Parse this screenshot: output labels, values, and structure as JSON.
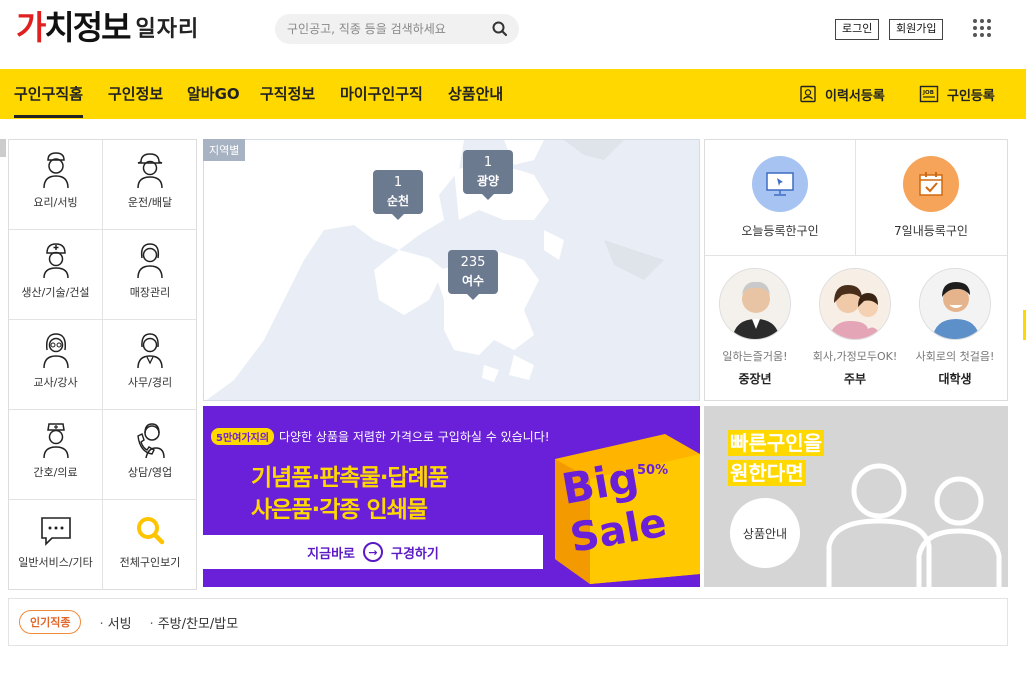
{
  "header": {
    "logo_brand": "가치정보",
    "logo_sub": "일자리",
    "search_placeholder": "구인공고, 직종 등을 검색하세요",
    "login": "로그인",
    "signup": "회원가입"
  },
  "nav": {
    "items": [
      "구인구직홈",
      "구인정보",
      "알바GO",
      "구직정보",
      "마이구인구직",
      "상품안내"
    ],
    "resume_register": "이력서등록",
    "job_register": "구인등록"
  },
  "categories": [
    "요리/서빙",
    "운전/배달",
    "생산/기술/건설",
    "매장관리",
    "교사/강사",
    "사무/경리",
    "간호/의료",
    "상담/영업",
    "일반서비스/기타",
    "전체구인보기"
  ],
  "map": {
    "tag": "지역별",
    "pins": [
      {
        "count": "1",
        "name": "순천"
      },
      {
        "count": "1",
        "name": "광양"
      },
      {
        "count": "235",
        "name": "여수"
      }
    ]
  },
  "right_panel": {
    "today": "오늘등록한구인",
    "week": "7일내등록구인",
    "personas": [
      {
        "desc": "일하는즐거움!",
        "name": "중장년"
      },
      {
        "desc": "회사,가정모두OK!",
        "name": "주부"
      },
      {
        "desc": "사회로의 첫걸음!",
        "name": "대학생"
      }
    ]
  },
  "banner": {
    "pill": "5만여가지의",
    "top_line": "다양한 상품을 저렴한 가격으로 구입하실 수 있습니다!",
    "line1": "기념품·판촉물·답례품",
    "line2": "사은품·각종 인쇄물",
    "cta_left": "지금바로",
    "cta_right": "구경하기",
    "percent": "50%",
    "big": "Big",
    "sale": "Sale"
  },
  "promo": {
    "line1": "빠른구인을",
    "line2": "원한다면",
    "button": "상품안내"
  },
  "popular": {
    "tag": "인기직종",
    "keywords": [
      "서빙",
      "주방/찬모/밥모"
    ]
  },
  "colors": {
    "nav_yellow": "#ffd800",
    "banner_purple": "#6a1fd8",
    "logo_red": "#e02020"
  }
}
